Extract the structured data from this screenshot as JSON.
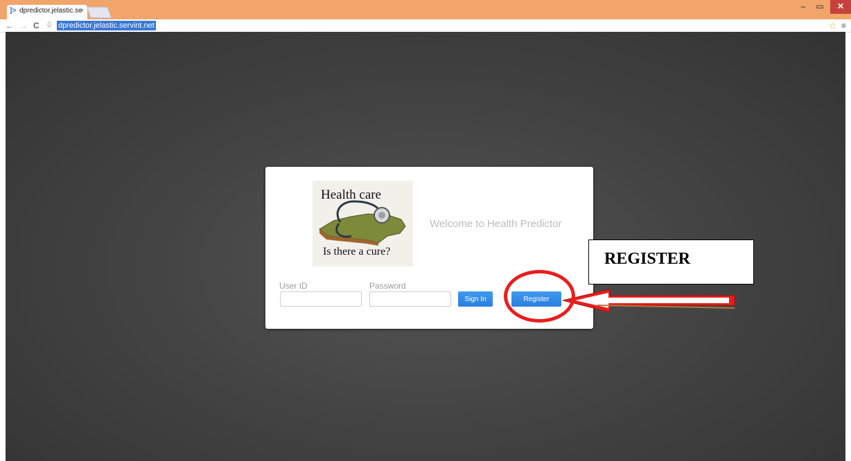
{
  "browser": {
    "tab_title": "dpredictor.jelastic.se",
    "tab_icon": "]>",
    "tab_close": "×",
    "url": "dpredictor.jelastic.servint.net",
    "window_controls": {
      "minimize": "–",
      "maximize": "▭",
      "close": "✕"
    },
    "nav": {
      "back": "←",
      "forward": "→",
      "reload": "C"
    }
  },
  "login": {
    "logo_line1": "Health care",
    "logo_line2": "Is there a cure?",
    "welcome": "Welcome to Health Predictor",
    "user_id_label": "User ID",
    "password_label": "Password",
    "user_id_value": "",
    "password_value": "",
    "sign_in_label": "Sign In",
    "register_label": "Register"
  },
  "annotation": {
    "callout_text": "REGISTER",
    "highlight_color": "#ea1d1d"
  },
  "colors": {
    "titlebar": "#f1a56a",
    "url_highlight": "#3877d6",
    "button": "#2b7ee0",
    "background": "#444444"
  }
}
